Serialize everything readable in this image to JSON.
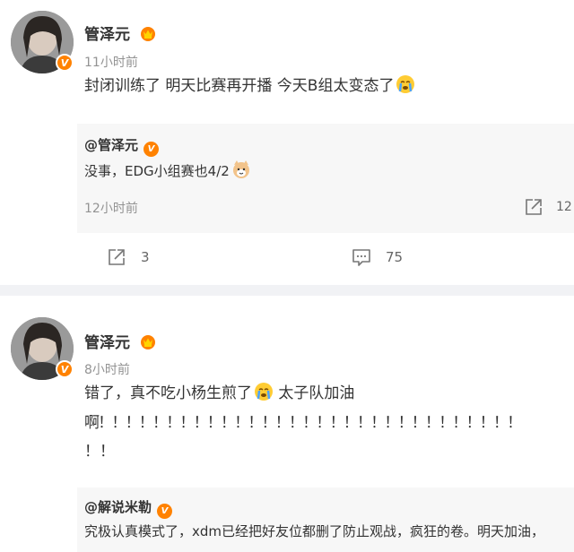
{
  "post1": {
    "author": "管泽元",
    "time": "11小时前",
    "text": "封闭训练了 明天比赛再开播 今天B组太变态了",
    "repost": {
      "author": "@管泽元",
      "text": "没事，EDG小组赛也4/2",
      "time": "12小时前",
      "share_count": "12"
    },
    "share_count": "3",
    "comment_count": "75"
  },
  "post2": {
    "author": "管泽元",
    "time": "8小时前",
    "text_line1": "错了，真不吃小杨生煎了",
    "text_line1b": " 太子队加油",
    "text_line2": "啊！！！！！！！！！！！！！！！！！！！！！！！！！！！！！！！",
    "text_line3": "！！",
    "repost": {
      "author": "@解说米勒",
      "text": "究极认真模式了，xdm已经把好友位都删了防止观战，疯狂的卷。明天加油，"
    }
  },
  "icons": {
    "verified": "verified-badge-icon",
    "crown": "crown-icon",
    "cry": "crying-emoji-icon",
    "cat": "cat-emoji-icon",
    "share": "share-icon",
    "comment": "comment-icon"
  },
  "colors": {
    "accent_orange": "#ff8200",
    "repost_bg": "#f7f7f7",
    "gap_bg": "#f1f2f5",
    "muted": "#939393"
  }
}
